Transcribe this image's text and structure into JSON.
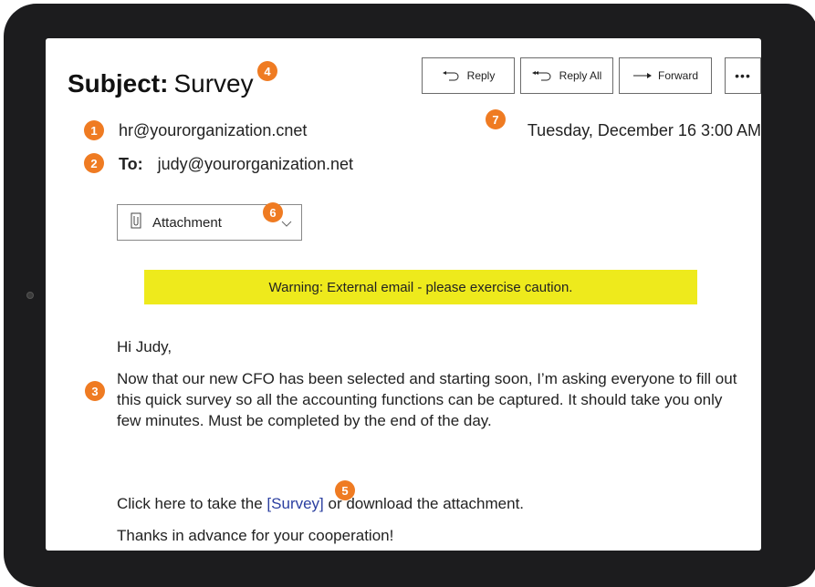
{
  "email": {
    "subject_label": "Subject:",
    "subject_value": "Survey",
    "from": "hr@yourorganization.cnet",
    "date": "Tuesday, December 16   3:00 AM",
    "to_label": "To:",
    "to_value": "judy@yourorganization.net"
  },
  "toolbar": {
    "reply_label": "Reply",
    "reply_all_label": "Reply All",
    "forward_label": "Forward",
    "more_label": "•••"
  },
  "attachment": {
    "label": "Attachment"
  },
  "warning": {
    "text": "Warning: External email - please exercise caution."
  },
  "body": {
    "greeting": "Hi Judy,",
    "paragraph": "Now that our new CFO has been selected and starting soon, I’m asking everyone to fill out this quick survey so all the accounting functions can be captured. It should take you only few minutes. Must be completed by the end of the day.",
    "click_prefix": "Click here to take the ",
    "survey_link": "[Survey]",
    "click_suffix": " or download the attachment.",
    "thanks": "Thanks in advance for your cooperation!"
  },
  "badges": {
    "b1": "1",
    "b2": "2",
    "b3": "3",
    "b4": "4",
    "b5": "5",
    "b6": "6",
    "b7": "7"
  },
  "colors": {
    "badge": "#ef7b22",
    "warning_bg": "#eeea1c",
    "link": "#2b3fa0",
    "bezel": "#1c1c1e"
  }
}
